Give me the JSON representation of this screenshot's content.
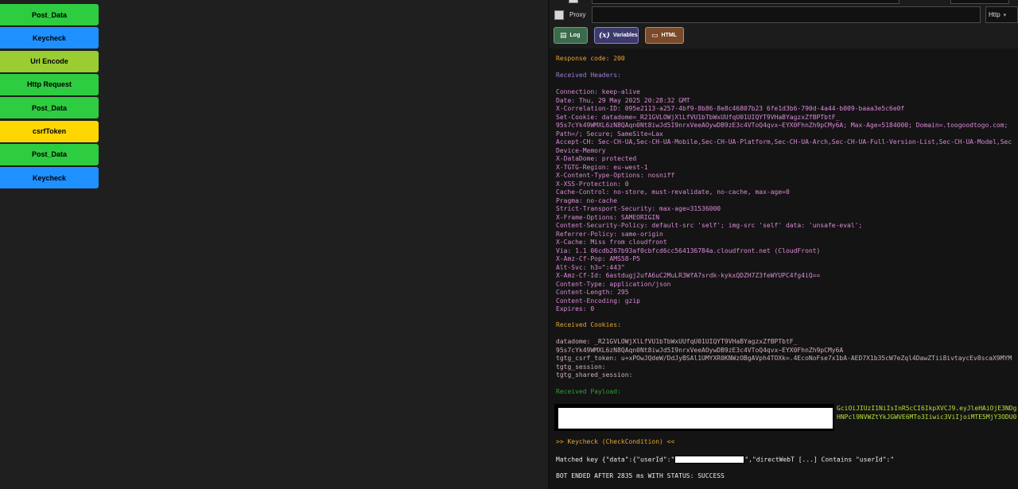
{
  "colors": {
    "green_block": "#2ecc40",
    "blue_block": "#1e90ff",
    "olive_block": "#9acd32",
    "yellow_block": "#ffd700",
    "log_button": "#3a6b4a",
    "variables_button": "#3d3b6e",
    "html_button": "#7a4a2a"
  },
  "blocks": [
    {
      "label": "Post_Data",
      "color": "green"
    },
    {
      "label": "Keycheck",
      "color": "blue"
    },
    {
      "label": "Url Encode",
      "color": "olive"
    },
    {
      "label": "Http Request",
      "color": "green"
    },
    {
      "label": "Post_Data",
      "color": "green"
    },
    {
      "label": "csrfToken",
      "color": "yellow"
    },
    {
      "label": "Post_Data",
      "color": "green"
    },
    {
      "label": "Keycheck",
      "color": "blue"
    }
  ],
  "proxy": {
    "label": "Proxy",
    "value": "",
    "type_value": "Http"
  },
  "tabs": [
    {
      "label": "Log",
      "icon": "log-icon"
    },
    {
      "label": "Variables",
      "icon": "variables-icon"
    },
    {
      "label": "HTML",
      "icon": "html-icon"
    }
  ],
  "log": {
    "response_code": "Response code: 200",
    "received_headers_title": "Received Headers:",
    "headers": [
      "Connection: keep-alive",
      "Date: Thu, 29 May 2025 20:28:32 GMT",
      "X-Correlation-ID: 095e2113-a257-4bf9-8b86-8e8c46807b23 6fe1d3b6-790d-4a44-b009-baaa3e5c6e0f",
      "Set-Cookie: datadome=_R21GVLOWjXlLfVU1bTbWxUUfqU01UIQYT9VHaBYagzxZfBPTbtF_",
      "95s7cYk49WMXL6zN8QAqn0Nt8iwJd5I9nrxVeeAOywDB9zE3c4VToQ4qvx~EYX0FhnZh9pCMy6A; Max-Age=5184000; Domain=.toogoodtogo.com;",
      "Path=/; Secure; SameSite=Lax",
      "Accept-CH: Sec-CH-UA,Sec-CH-UA-Mobile,Sec-CH-UA-Platform,Sec-CH-UA-Arch,Sec-CH-UA-Full-Version-List,Sec-CH-UA-Model,Sec",
      "Device-Memory",
      "X-DataDome: protected",
      "X-TGTG-Region: eu-west-1",
      "X-Content-Type-Options: nosniff",
      "X-XSS-Protection: 0",
      "Cache-Control: no-store, must-revalidate, no-cache, max-age=0",
      "Pragma: no-cache",
      "Strict-Transport-Security: max-age=31536000",
      "X-Frame-Options: SAMEORIGIN",
      "Content-Security-Policy: default-src 'self'; img-src 'self' data: 'unsafe-eval';",
      "Referrer-Policy: same-origin",
      "X-Cache: Miss from cloudfront",
      "Via: 1.1 06cdb267b93af0cbfcd6cc564136784a.cloudfront.net (CloudFront)",
      "X-Amz-Cf-Pop: AMS58-P5",
      "Alt-Svc: h3=\":443\"",
      "X-Amz-Cf-Id: 6astdugj2ufA6uC2MuLR3WfA7srdk-kykxQDZH7Z3feWYUPC4fg4iQ==",
      "Content-Type: application/json",
      "Content-Length: 295",
      "Content-Encoding: gzip",
      "Expires: 0"
    ],
    "received_cookies_title": "Received Cookies:",
    "cookies": [
      "datadome: _R21GVLOWjXlLfVU1bTbWxUUfqU01UIQYT9VHaBYagzxZfBPTbtF_",
      "95s7cYk49WMXL6zN8QAqn0Nt8iwJd5I9nrxVeeAOywDB9zE3c4VToQ4qvx~EYX0FhnZh9pCMy6A",
      "tgtg_csrf_token: u+xPOwJQdeW/DdJyBSAl1UMYXR0KNWzOBgAVph4TOXk=.4EcoNoFse7x1bA-AED7X1b35cW7eZql4DawZTii8ivtaycEv8scaX9MYM",
      "tgtg_session:",
      "tgtg_shared_session:"
    ],
    "received_payload_title": "Received Payload:",
    "payload_lines": [
      "GciOiJIUzI1NiIsInR5cCI6IkpXVCJ9.eyJleHAiOjE3NDg",
      "HNPcl9NVWZtYkJGWVE6MTo3Iiwic3ViIjoiMTE5MjY3ODU0"
    ],
    "keycheck_title": ">> Keycheck (CheckCondition) <<",
    "matched_prefix": "Matched key {\"data\":{\"userId\":\"",
    "matched_suffix": "\",\"directWebT [...] Contains \"userId\":\"",
    "bot_status": "BOT ENDED AFTER 2835 ms WITH STATUS: SUCCESS"
  }
}
